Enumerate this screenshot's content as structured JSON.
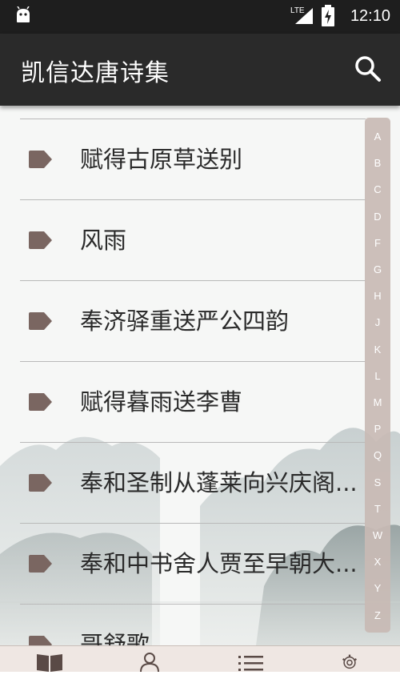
{
  "status_bar": {
    "network": "LTE",
    "time": "12:10"
  },
  "app_bar": {
    "title": "凯信达唐诗集"
  },
  "poems": [
    {
      "title": "赋得古原草送别"
    },
    {
      "title": "风雨"
    },
    {
      "title": "奉济驿重送严公四韵"
    },
    {
      "title": "赋得暮雨送李曹"
    },
    {
      "title": "奉和圣制从蓬莱向兴庆阁..."
    },
    {
      "title": "奉和中书舍人贾至早朝大..."
    },
    {
      "title": "哥舒歌"
    }
  ],
  "index_letters": [
    "A",
    "B",
    "C",
    "D",
    "F",
    "G",
    "H",
    "J",
    "K",
    "L",
    "M",
    "P",
    "Q",
    "S",
    "T",
    "W",
    "X",
    "Y",
    "Z"
  ],
  "colors": {
    "status_bar": "#1e1e1e",
    "app_bar": "#2a2a2a",
    "tag_icon": "#7a6661",
    "index_bar": "#c8bab4",
    "bottom_nav": "#efe7e3"
  },
  "bottom_nav": {
    "items": [
      {
        "icon": "book-icon"
      },
      {
        "icon": "person-icon"
      },
      {
        "icon": "list-icon"
      },
      {
        "icon": "gear-icon"
      }
    ]
  }
}
